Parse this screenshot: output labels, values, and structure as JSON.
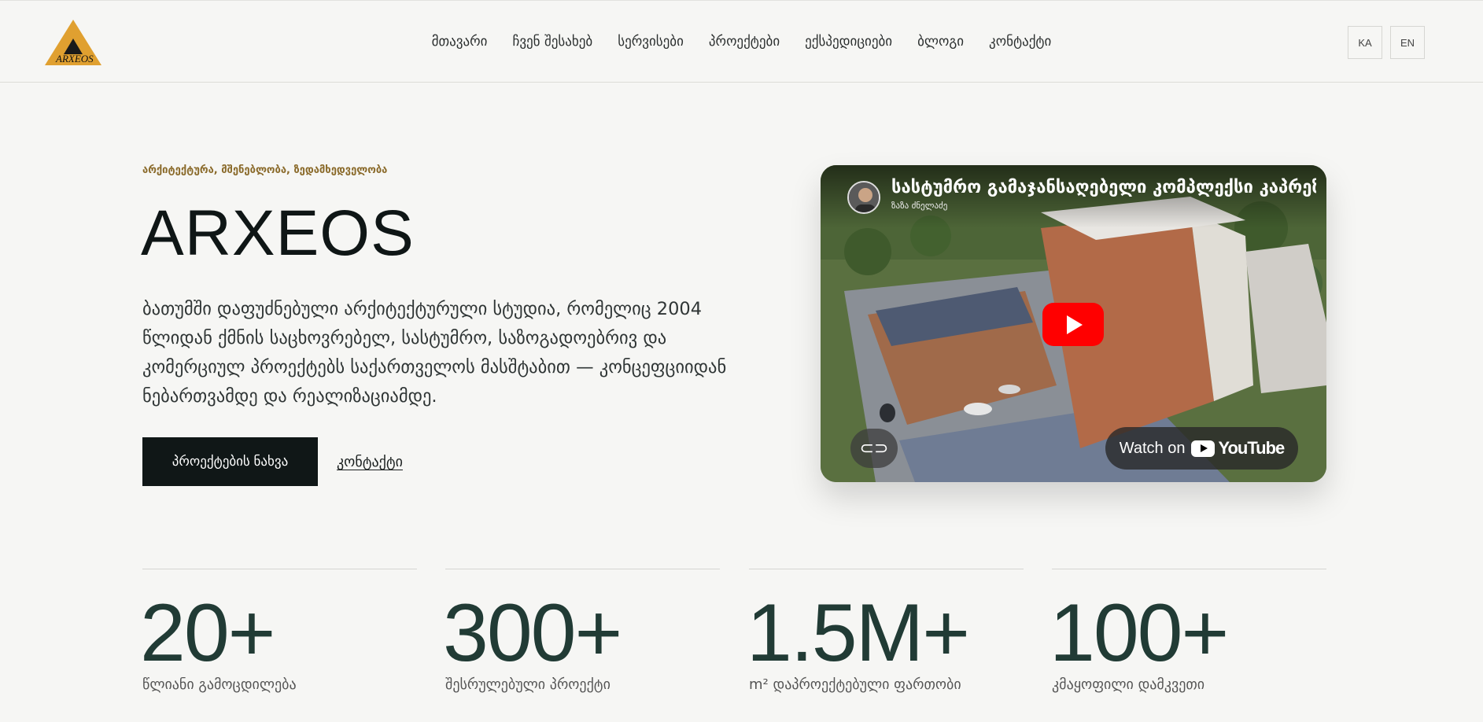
{
  "brand": {
    "logo_text": "ARXEOS",
    "accent_color": "#e0a030"
  },
  "nav": {
    "items": [
      "მთავარი",
      "ჩვენ შესახებ",
      "სერვისები",
      "პროექტები",
      "ექსპედიციები",
      "ბლოგი",
      "კონტაქტი"
    ]
  },
  "lang": {
    "ka": "KA",
    "en": "EN"
  },
  "hero": {
    "eyebrow": "არქიტექტურა, მშენებლობა, ზედამხედველობა",
    "title": "ARXEOS",
    "description": "ბათუმში დაფუძნებული არქიტექტურული სტუდია, რომელიც 2004 წლიდან ქმნის საცხოვრებელ, სასტუმრო, საზოგადოებრივ და კომერციულ პროექტებს საქართველოს მასშტაბით — კონცეფციიდან ნებართვამდე და რეალიზაციამდე.",
    "primary_button": "პროექტების ნახვა",
    "secondary_link": "კონტაქტი"
  },
  "video": {
    "title": "სასტუმრო გამაჯანსაღებელი კომპლექსი კაპრეზი",
    "channel": "ზაზა ძნელაძე",
    "watch_on": "Watch on",
    "youtube": "YouTube"
  },
  "stats": [
    {
      "value": "20+",
      "label": "წლიანი გამოცდილება"
    },
    {
      "value": "300+",
      "label": "შესრულებული პროექტი"
    },
    {
      "value": "1.5M+",
      "label": "m² დაპროექტებული ფართობი"
    },
    {
      "value": "100+",
      "label": "კმაყოფილი დამკვეთი"
    }
  ]
}
